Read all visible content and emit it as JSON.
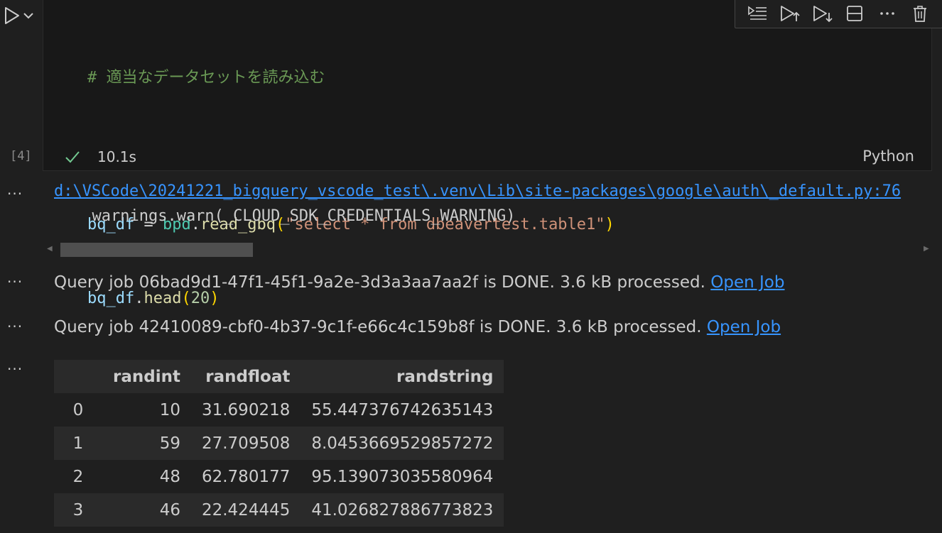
{
  "cell": {
    "code": {
      "comment": "# 適当なデータセットを読み込む",
      "line2_var": "bq_df",
      "line2_eq": " = ",
      "line2_mod": "bpd",
      "line2_dot": ".",
      "line2_fn": "read_gbq",
      "line2_open": "(",
      "line2_str": "\"select * from dbeavertest.table1\"",
      "line2_close": ")",
      "line3_var": "bq_df",
      "line3_dot": ".",
      "line3_fn": "head",
      "line3_open": "(",
      "line3_num": "20",
      "line3_close": ")"
    },
    "execution_count": "[4]",
    "exec_time": "10.1s",
    "language": "Python",
    "toolbar_icons": [
      "execute-above-icon",
      "run-above-icon",
      "run-below-icon",
      "split-cell-icon",
      "more-actions-icon",
      "delete-icon"
    ]
  },
  "outputs": {
    "more_label": "···",
    "warning_link": "d:\\VSCode\\20241221_bigquery_vscode_test\\.venv\\Lib\\site-packages\\google\\auth\\_default.py:76",
    "warning_text": "  warnings.warn(_CLOUD_SDK_CREDENTIALS_WARNING)",
    "job1_text": "Query job 06bad9d1-47f1-45f1-9a2e-3d3a3aa7aa2f is DONE. 3.6 kB processed. ",
    "job2_text": "Query job 42410089-cbf0-4b37-9c1f-e66c4c159b8f is DONE. 3.6 kB processed. ",
    "job_link": "Open Job"
  },
  "table": {
    "columns": [
      "",
      "randint",
      "randfloat",
      "randstring"
    ],
    "rows": [
      [
        "0",
        "10",
        "31.690218",
        "55.447376742635143"
      ],
      [
        "1",
        "59",
        "27.709508",
        "8.0453669529857272"
      ],
      [
        "2",
        "48",
        "62.780177",
        "95.139073035580964"
      ],
      [
        "3",
        "46",
        "22.424445",
        "41.026827886773823"
      ]
    ]
  },
  "colors": {
    "background": "#1f1f1f",
    "link": "#3794ff",
    "success": "#73c991"
  }
}
